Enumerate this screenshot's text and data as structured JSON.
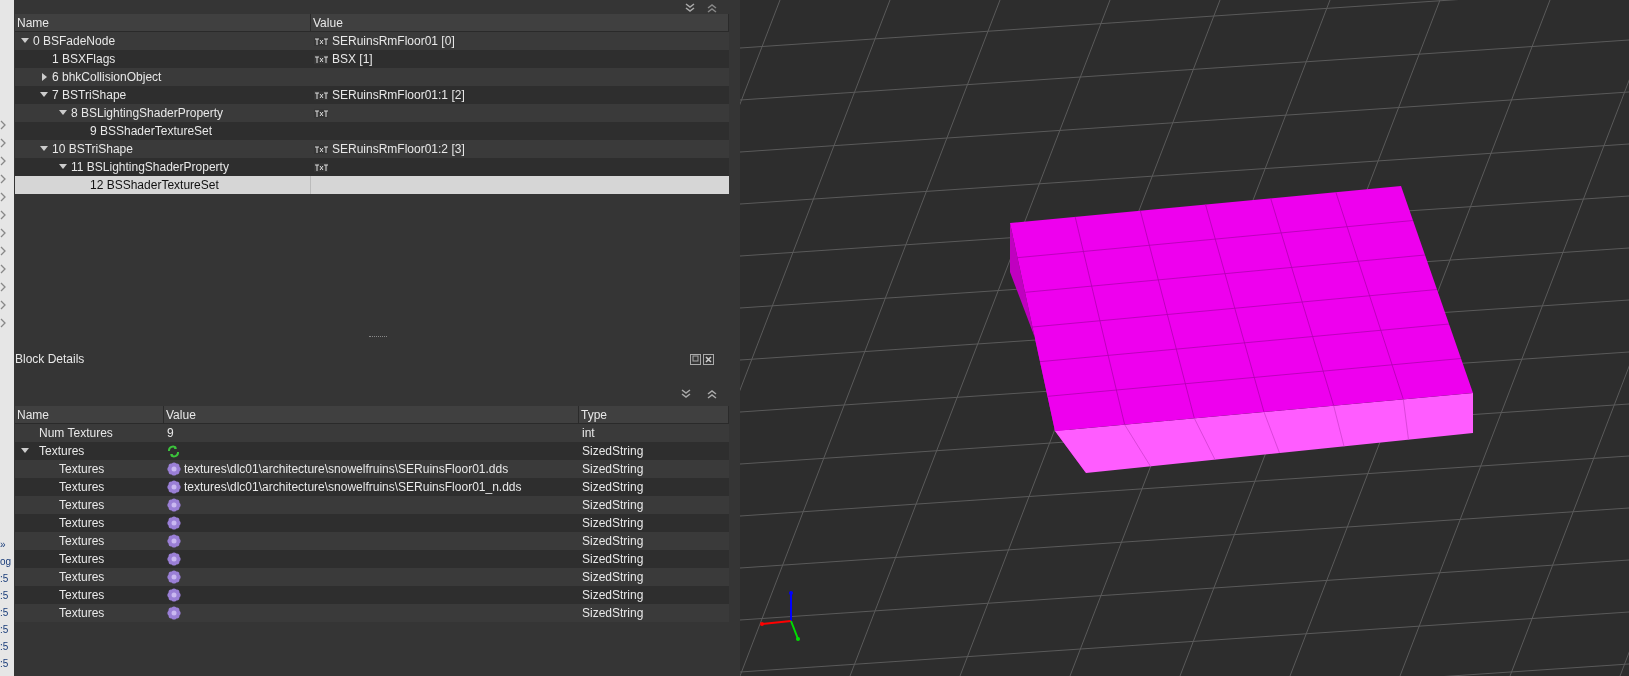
{
  "side_strip": {
    "fragments": [
      "»",
      "og",
      ":5",
      ":5",
      ":5",
      ":5",
      ":5",
      ":5"
    ]
  },
  "block_list": {
    "columns": [
      "Name",
      "Value"
    ],
    "rows": [
      {
        "name": "0 BSFadeNode",
        "value": "SERuinsRmFloor01 [0]",
        "txt_icon": true,
        "expanded": true,
        "selected": false,
        "children": [
          {
            "name": "1 BSXFlags",
            "value": "BSX [1]",
            "txt_icon": true,
            "selected": false
          },
          {
            "name": "6 bhkCollisionObject",
            "expanded": false,
            "selected": false
          },
          {
            "name": "7 BSTriShape",
            "value": "SERuinsRmFloor01:1 [2]",
            "txt_icon": true,
            "expanded": true,
            "selected": false,
            "children": [
              {
                "name": "8 BSLightingShaderProperty",
                "txt_icon": true,
                "expanded": true,
                "selected": false,
                "children": [
                  {
                    "name": "9 BSShaderTextureSet",
                    "selected": false
                  }
                ]
              }
            ]
          },
          {
            "name": "10 BSTriShape",
            "value": "SERuinsRmFloor01:2 [3]",
            "txt_icon": true,
            "expanded": true,
            "selected": false,
            "children": [
              {
                "name": "11 BSLightingShaderProperty",
                "txt_icon": true,
                "expanded": true,
                "selected": false,
                "children": [
                  {
                    "name": "12 BSShaderTextureSet",
                    "selected": true
                  }
                ]
              }
            ]
          }
        ]
      }
    ]
  },
  "block_details": {
    "title": "Block Details",
    "columns": [
      "Name",
      "Value",
      "Type"
    ],
    "rows": [
      {
        "kind": "number",
        "name": "Num Textures",
        "value": "9",
        "type": "int"
      },
      {
        "kind": "array",
        "name": "Textures",
        "type": "SizedString",
        "expanded": true,
        "children": [
          {
            "kind": "string",
            "name": "Textures",
            "value": "textures\\dlc01\\architecture\\snowelfruins\\SERuinsFloor01.dds",
            "type": "SizedString"
          },
          {
            "kind": "string",
            "name": "Textures",
            "value": "textures\\dlc01\\architecture\\snowelfruins\\SERuinsFloor01_n.dds",
            "type": "SizedString"
          },
          {
            "kind": "string",
            "name": "Textures",
            "type": "SizedString"
          },
          {
            "kind": "string",
            "name": "Textures",
            "type": "SizedString"
          },
          {
            "kind": "string",
            "name": "Textures",
            "type": "SizedString"
          },
          {
            "kind": "string",
            "name": "Textures",
            "type": "SizedString"
          },
          {
            "kind": "string",
            "name": "Textures",
            "type": "SizedString"
          },
          {
            "kind": "string",
            "name": "Textures",
            "type": "SizedString"
          },
          {
            "kind": "string",
            "name": "Textures",
            "type": "SizedString"
          }
        ]
      }
    ]
  }
}
